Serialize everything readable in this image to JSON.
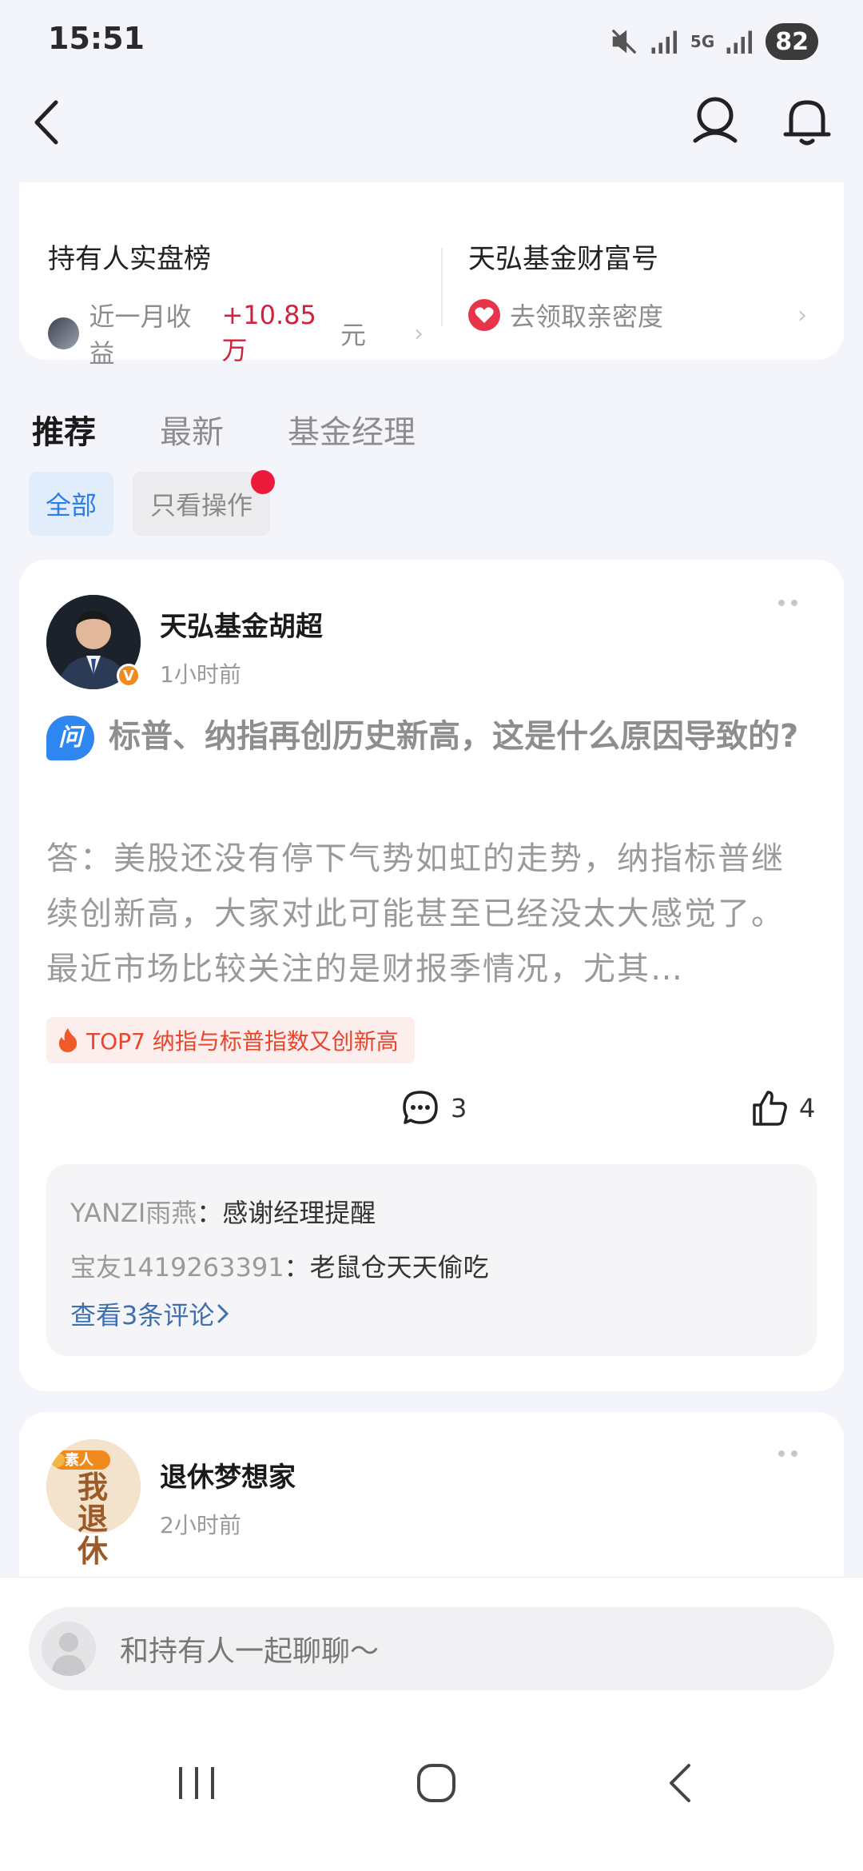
{
  "status_bar": {
    "time": "15:51",
    "network": "5G",
    "battery": "82"
  },
  "top_card": {
    "left": {
      "title": "持有人实盘榜",
      "sub_label": "近一月收益",
      "sub_value": "+10.85万",
      "sub_unit": "元"
    },
    "right": {
      "title": "天弘基金财富号",
      "sub_label": "去领取亲密度"
    }
  },
  "tabs": [
    {
      "label": "推荐",
      "active": true
    },
    {
      "label": "最新",
      "active": false
    },
    {
      "label": "基金经理",
      "active": false
    }
  ],
  "filters": [
    {
      "label": "全部",
      "selected": true
    },
    {
      "label": "只看操作",
      "selected": false
    }
  ],
  "posts": [
    {
      "author": "天弘基金胡超",
      "time": "1小时前",
      "verified_badge": "V",
      "question_badge": "问",
      "question": "标普、纳指再创历史新高，这是什么原因导致的?",
      "answer": "答：美股还没有停下气势如虹的走势，纳指标普继续创新高，大家对此可能甚至已经没太大感觉了。最近市场比较关注的是财报季情况，尤其…",
      "topic": "TOP7 纳指与标普指数又创新高",
      "comment_count": "3",
      "like_count": "4",
      "comments": [
        {
          "user": "YANZI雨燕",
          "text": "感谢经理提醒"
        },
        {
          "user": "宝友1419263391",
          "text": "老鼠仓天天偷吃"
        }
      ],
      "view_more": "查看3条评论"
    },
    {
      "author": "退休梦想家",
      "time": "2小时前",
      "avatar_badge": "素人",
      "avatar_text": "我退休"
    }
  ],
  "chat_input": {
    "placeholder": "和持有人一起聊聊～"
  },
  "colors": {
    "accent_blue": "#2b7de9",
    "gain_red": "#d0223c",
    "topic_orange": "#e8452c"
  }
}
